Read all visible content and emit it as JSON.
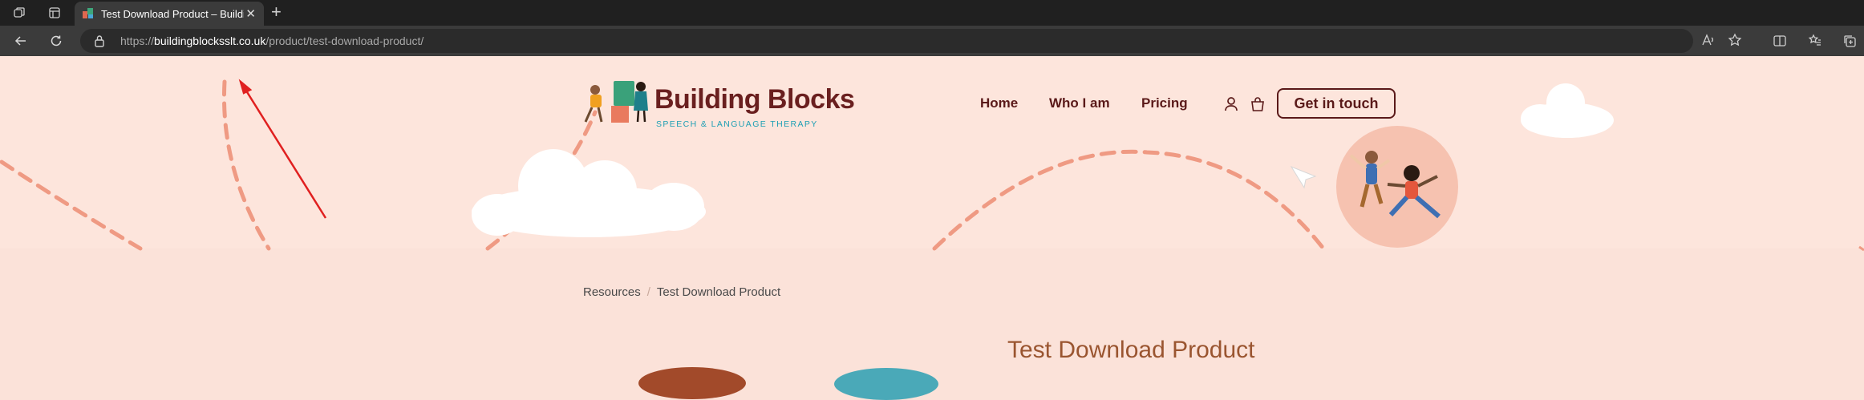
{
  "browser": {
    "tab": {
      "title": "Test Download Product – Building Blocks",
      "close_label": "✕"
    },
    "new_tab_label": "+",
    "url": {
      "scheme": "https://",
      "host": "buildingblocksslt.co.uk",
      "path": "/product/test-download-product/"
    }
  },
  "site": {
    "brand": {
      "name": "Building Blocks",
      "tagline": "SPEECH & LANGUAGE THERAPY"
    },
    "nav": [
      {
        "label": "Home"
      },
      {
        "label": "Who I am"
      },
      {
        "label": "Pricing"
      }
    ],
    "cta_label": "Get in touch",
    "icons": {
      "account": "user-icon",
      "cart": "bag-icon"
    }
  },
  "breadcrumb": {
    "parent": "Resources",
    "separator": "/",
    "current": "Test Download Product"
  },
  "product": {
    "title": "Test Download Product"
  },
  "colors": {
    "accent": "#5a1919",
    "brand_teal": "#1e9fb4",
    "page_bg": "#fbe2d9",
    "title": "#9a5530",
    "dash": "#ef9a83"
  }
}
